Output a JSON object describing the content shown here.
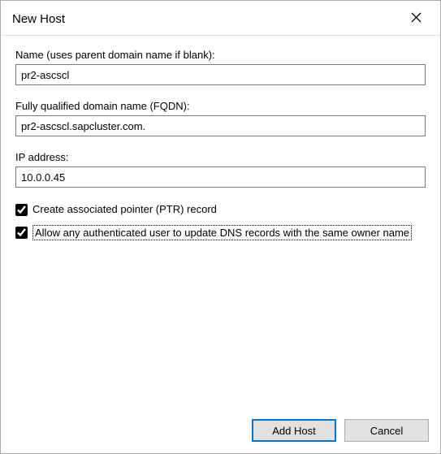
{
  "dialog": {
    "title": "New Host"
  },
  "fields": {
    "name": {
      "label": "Name (uses parent domain name if blank):",
      "value": "pr2-ascscl"
    },
    "fqdn": {
      "label": "Fully qualified domain name (FQDN):",
      "value": "pr2-ascscl.sapcluster.com."
    },
    "ip": {
      "label": "IP address:",
      "value": "10.0.0.45"
    }
  },
  "checkboxes": {
    "ptr": {
      "label": "Create associated pointer (PTR) record",
      "checked": true
    },
    "allow_update": {
      "label": "Allow any authenticated user to update DNS records with the same owner name",
      "checked": true
    }
  },
  "buttons": {
    "add_host": "Add Host",
    "cancel": "Cancel"
  }
}
